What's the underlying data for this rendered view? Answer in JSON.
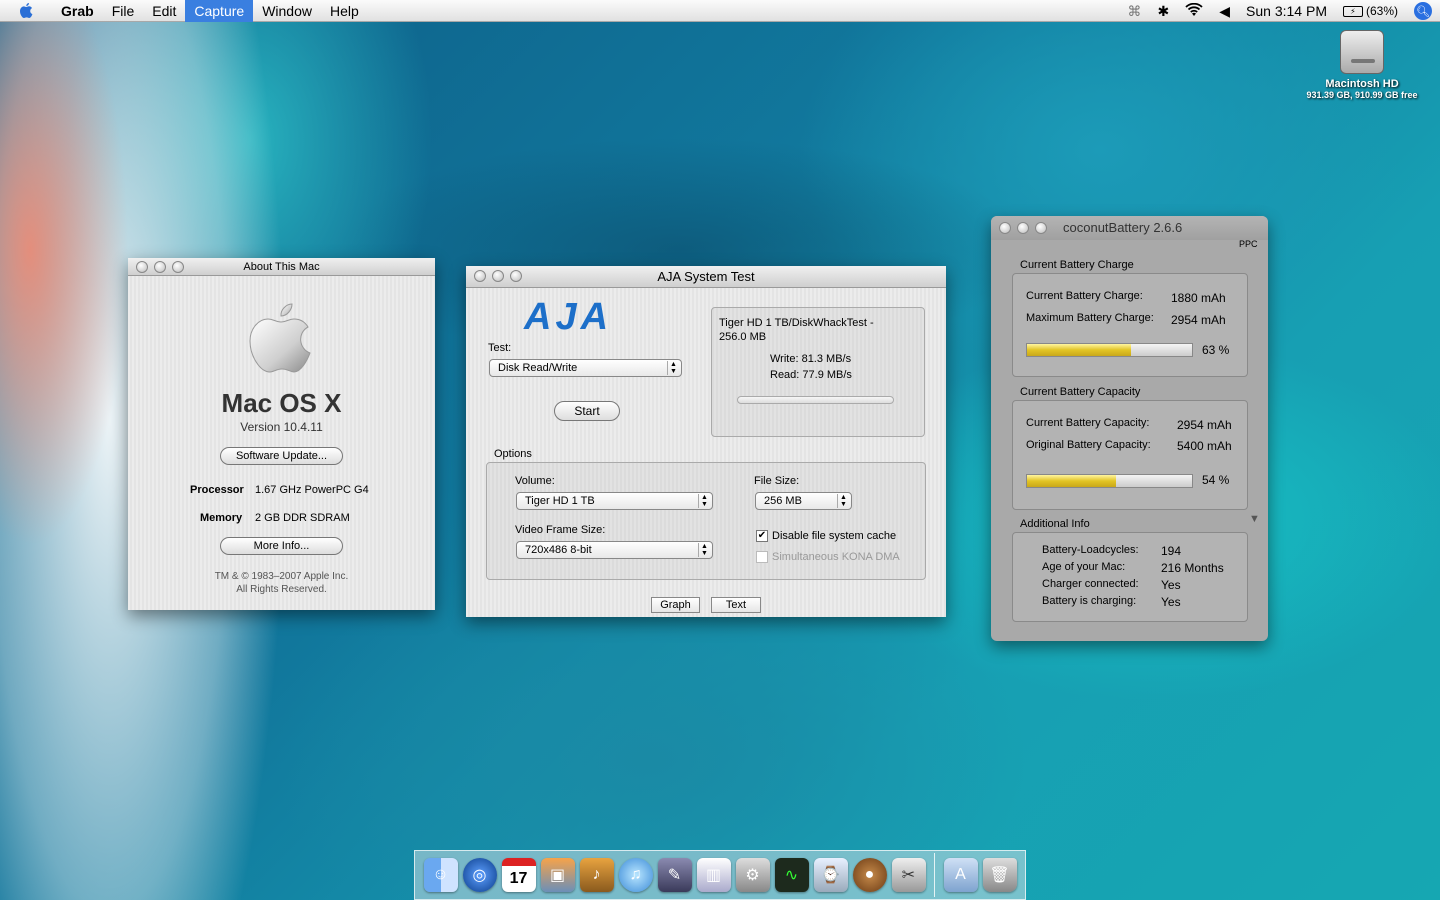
{
  "menubar": {
    "app": "Grab",
    "items": [
      "File",
      "Edit",
      "Capture",
      "Window",
      "Help"
    ],
    "clock": "Sun 3:14 PM",
    "battery": "(63%)"
  },
  "desktop": {
    "hd_name": "Macintosh HD",
    "hd_size": "931.39 GB, 910.99 GB free"
  },
  "about": {
    "title": "About This Mac",
    "os_name": "Mac OS X",
    "version": "Version 10.4.11",
    "software_update": "Software Update...",
    "processor_label": "Processor",
    "processor_value": "1.67 GHz PowerPC G4",
    "memory_label": "Memory",
    "memory_value": "2 GB DDR SDRAM",
    "more_info": "More Info...",
    "copyright1": "TM & © 1983–2007 Apple Inc.",
    "copyright2": "All Rights Reserved."
  },
  "aja": {
    "title": "AJA System Test",
    "logo": "AJA",
    "test_label": "Test:",
    "test_value": "Disk Read/Write",
    "start": "Start",
    "result_path1": "Tiger HD 1 TB/DiskWhackTest -",
    "result_path2": "256.0 MB",
    "write": "Write: 81.3 MB/s",
    "read": "Read: 77.9 MB/s",
    "options_label": "Options",
    "volume_label": "Volume:",
    "volume_value": "Tiger HD 1 TB",
    "filesize_label": "File Size:",
    "filesize_value": "256 MB",
    "frame_label": "Video Frame Size:",
    "frame_value": "720x486 8-bit",
    "disable_cache": "Disable file system cache",
    "kona": "Simultaneous KONA DMA",
    "graph": "Graph",
    "text": "Text"
  },
  "coconut": {
    "title": "coconutBattery 2.6.6",
    "ppc": "PPC",
    "charge_group": "Current Battery Charge",
    "cur_charge_label": "Current Battery Charge:",
    "cur_charge_value": "1880 mAh",
    "max_charge_label": "Maximum Battery Charge:",
    "max_charge_value": "2954 mAh",
    "charge_pct": "63 %",
    "charge_fraction": 0.63,
    "capacity_group": "Current Battery Capacity",
    "cur_cap_label": "Current Battery Capacity:",
    "cur_cap_value": "2954 mAh",
    "orig_cap_label": "Original Battery Capacity:",
    "orig_cap_value": "5400 mAh",
    "cap_pct": "54 %",
    "cap_fraction": 0.54,
    "additional": "Additional Info",
    "loadcycles_label": "Battery-Loadcycles:",
    "loadcycles_value": "194",
    "age_label": "Age of your Mac:",
    "age_value": "216 Months",
    "charger_label": "Charger connected:",
    "charger_value": "Yes",
    "charging_label": "Battery is charging:",
    "charging_value": "Yes"
  },
  "dock": {
    "calendar_day": "17"
  }
}
